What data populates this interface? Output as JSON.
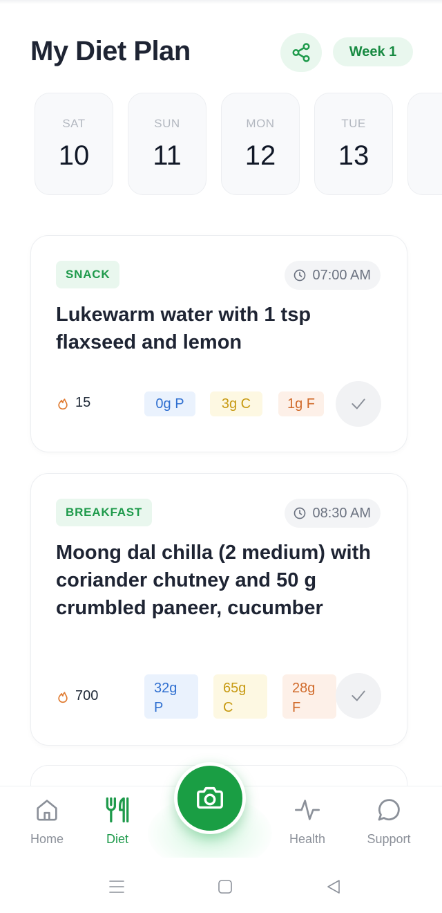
{
  "header": {
    "title": "My Diet Plan",
    "week_label": "Week 1",
    "share_icon": "share-icon"
  },
  "days": [
    {
      "dow": "SAT",
      "num": "10"
    },
    {
      "dow": "SUN",
      "num": "11"
    },
    {
      "dow": "MON",
      "num": "12"
    },
    {
      "dow": "TUE",
      "num": "13"
    }
  ],
  "meals": [
    {
      "type": "SNACK",
      "time": "07:00 AM",
      "name": "Lukewarm water with 1 tsp flaxseed and lemon",
      "calories": "15",
      "protein": "0g P",
      "carbs": "3g C",
      "fat": "1g F"
    },
    {
      "type": "BREAKFAST",
      "time": "08:30 AM",
      "name": "Moong dal chilla (2 medium) with coriander chutney and 50 g crumbled paneer, cucumber",
      "calories": "700",
      "protein": "32g P",
      "carbs": "65g C",
      "fat": "28g F"
    }
  ],
  "nav": {
    "home": "Home",
    "diet": "Diet",
    "health": "Health",
    "support": "Support"
  },
  "colors": {
    "accent": "#1a9e44",
    "accent_bg": "#e9f7ee",
    "protein": "#2f6fd0",
    "carbs": "#c79a12",
    "fat": "#d06a2a"
  }
}
